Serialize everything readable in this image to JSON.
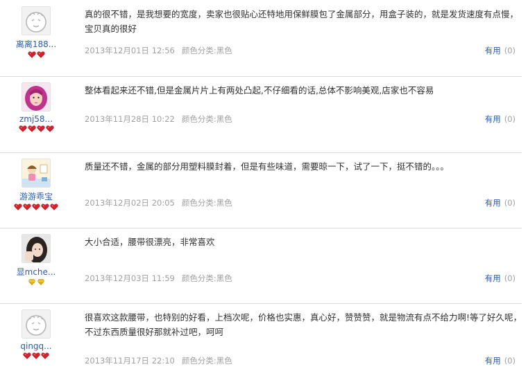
{
  "reviews": [
    {
      "username": "离离188...",
      "avatar": "default-avatar",
      "badge_type": "red-heart",
      "badge_count": 2,
      "text": "真的很不错，是我想要的宽度，卖家也很贴心还特地用保鲜膜包了金属部分，用盒子装的，就是发货速度有点慢，宝贝真的很好",
      "date": "2013年12月01日 12:56",
      "color_category": "颜色分类:黑色",
      "helpful_label": "有用",
      "helpful_count": "(0)"
    },
    {
      "username": "zmj58...",
      "avatar": "photo-pink-hair",
      "badge_type": "red-heart",
      "badge_count": 4,
      "text": "整体看起来还不错,但是金属片片上有两处凸起,不仔细看的话,总体不影响美观,店家也不容易",
      "date": "2013年11月28日 10:22",
      "color_category": "颜色分类:黑色",
      "helpful_label": "有用",
      "helpful_count": "(0)"
    },
    {
      "username": "游游乖宝",
      "avatar": "photo-cartoon-room",
      "badge_type": "red-heart",
      "badge_count": 5,
      "text": "质量还不错，金属的部分用塑料膜封着，但是有些味道，需要晾一下，试了一下，挺不错的。。。",
      "date": "2013年12月02日 20:05",
      "color_category": "颜色分类:黑色",
      "helpful_label": "有用",
      "helpful_count": "(0)"
    },
    {
      "username": "显mche...",
      "avatar": "photo-dark-hair",
      "badge_type": "gold-diamond",
      "badge_count": 2,
      "text": "大小合适，腰带很漂亮，非常喜欢",
      "date": "2013年12月03日 11:59",
      "color_category": "颜色分类:黑色",
      "helpful_label": "有用",
      "helpful_count": "(0)"
    },
    {
      "username": "qingq...",
      "avatar": "default-avatar",
      "badge_type": "red-heart",
      "badge_count": 3,
      "text": "很喜欢这款腰带，也特别的好看，上档次呢，价格也实惠，真心好，赞赞赞，就是物流有点不给力啊!等了好久呢，不过东西质量很好那就补过吧，呵呵",
      "date": "2013年11月17日 22:10",
      "color_category": "颜色分类:黑色",
      "helpful_label": "有用",
      "helpful_count": "(0)"
    }
  ],
  "colors": {
    "link": "#2a5ca8",
    "meta_text": "#a0a0a0",
    "divider": "#d9d9d9",
    "heart": "#d2222d",
    "diamond": "#e7b400"
  }
}
